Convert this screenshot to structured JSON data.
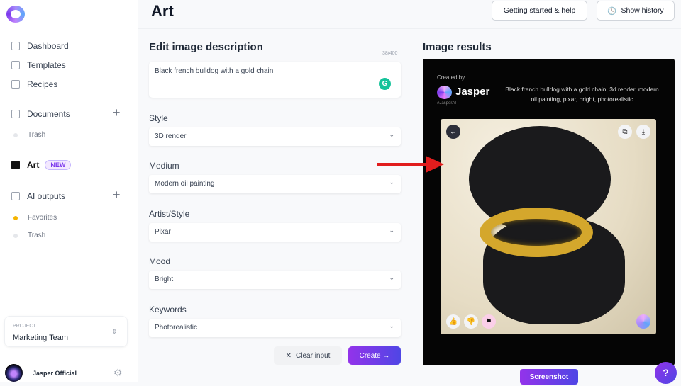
{
  "sidebar": {
    "items": [
      {
        "label": "Dashboard",
        "icon": "home-icon"
      },
      {
        "label": "Templates",
        "icon": "grid-icon"
      },
      {
        "label": "Recipes",
        "icon": "recipe-icon"
      },
      {
        "label": "Documents",
        "icon": "document-icon"
      },
      {
        "label": "Trash"
      },
      {
        "label": "Art",
        "icon": "image-icon",
        "badge": "NEW"
      },
      {
        "label": "AI outputs",
        "icon": "inbox-icon"
      },
      {
        "label": "Favorites",
        "dot_color": "#f5b400"
      },
      {
        "label": "Trash"
      }
    ],
    "project": {
      "label": "PROJECT",
      "value": "Marketing Team"
    },
    "user": {
      "name": "Jasper Official"
    }
  },
  "header": {
    "title": "Art",
    "getting_started": "Getting started & help",
    "show_history": "Show history"
  },
  "form": {
    "title": "Edit image description",
    "count": "38/400",
    "description": "Black french bulldog with a gold chain",
    "fields": [
      {
        "label": "Style",
        "value": "3D render"
      },
      {
        "label": "Medium",
        "value": "Modern oil painting"
      },
      {
        "label": "Artist/Style",
        "value": "Pixar"
      },
      {
        "label": "Mood",
        "value": "Bright"
      },
      {
        "label": "Keywords",
        "value": "Photorealistic"
      }
    ],
    "clear": "Clear input",
    "create": "Create →"
  },
  "results": {
    "title": "Image results",
    "created_by": "Created by",
    "brand": "Jasper",
    "tag": "#JasperAI",
    "prompt": "Black french bulldog with a gold chain, 3d render, modern oil painting, pixar, bright, photorealistic"
  },
  "screenshot": "Screenshot",
  "help": "?",
  "colors": {
    "accent": "#7c3aed",
    "annotation_arrow": "#e11d1d"
  }
}
